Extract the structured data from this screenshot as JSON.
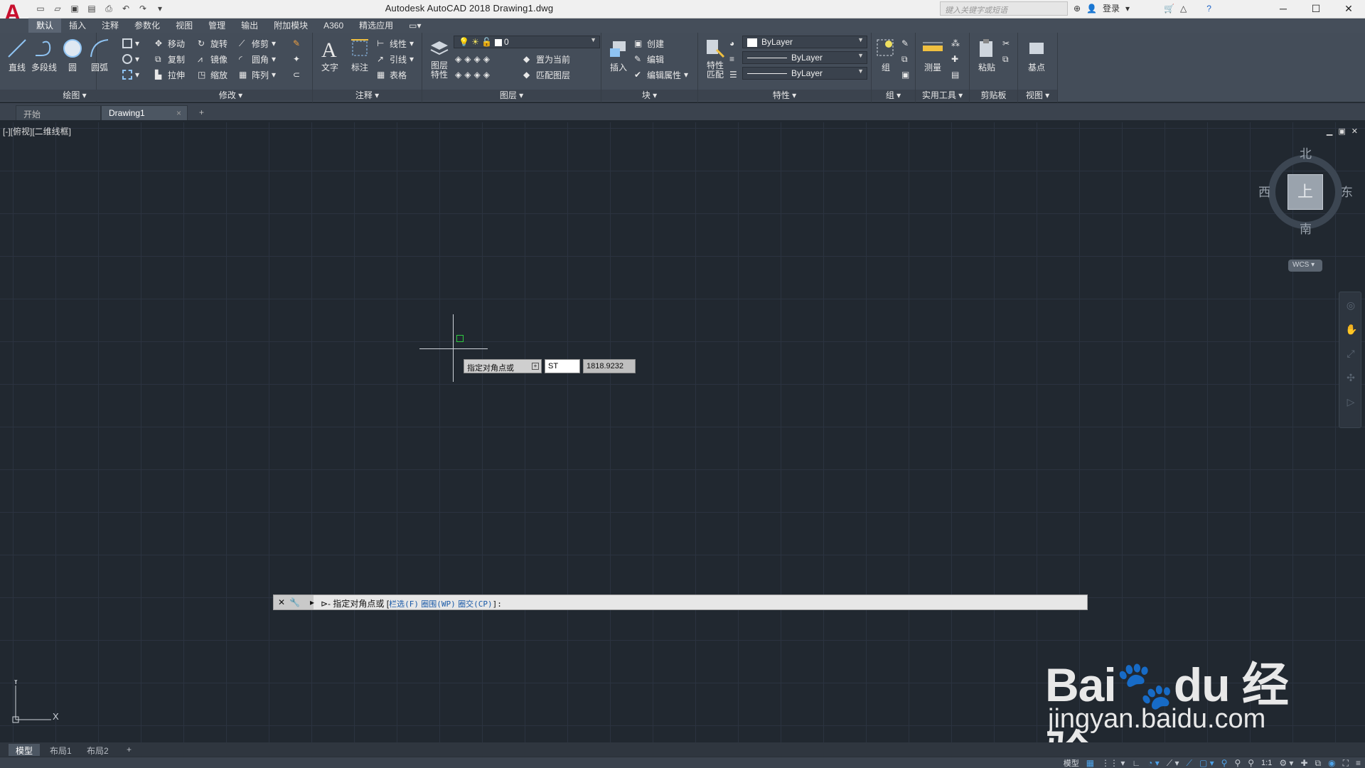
{
  "window": {
    "title": "Autodesk AutoCAD 2018    Drawing1.dwg",
    "search_placeholder": "键入关键字或短语",
    "login_label": "登录",
    "minimize": "─",
    "maximize": "☐",
    "close": "✕"
  },
  "ribbon_tabs": [
    "默认",
    "插入",
    "注释",
    "参数化",
    "视图",
    "管理",
    "输出",
    "附加模块",
    "A360",
    "精选应用"
  ],
  "ribbon": {
    "draw": {
      "title": "绘图 ▾",
      "line": "直线",
      "polyline": "多段线",
      "circle": "圆",
      "arc": "圆弧"
    },
    "modify": {
      "title": "修改 ▾",
      "move": "移动",
      "rotate": "旋转",
      "trim": "修剪",
      "copy": "复制",
      "mirror": "镜像",
      "fillet": "圆角",
      "stretch": "拉伸",
      "scale": "缩放",
      "array": "阵列"
    },
    "annotation": {
      "title": "注释 ▾",
      "text": "文字",
      "dimension": "标注",
      "linear": "线性",
      "leader": "引线",
      "table": "表格"
    },
    "layers": {
      "title": "图层 ▾",
      "layer_properties": "图层\n特性",
      "layer_value": "0",
      "set_current": "置为当前",
      "match_layer": "匹配图层"
    },
    "block": {
      "title": "块 ▾",
      "insert": "插入",
      "create": "创建",
      "edit": "编辑",
      "edit_attributes": "编辑属性"
    },
    "properties": {
      "title": "特性 ▾",
      "match": "特性\n匹配",
      "color": "ByLayer",
      "linetype": "ByLayer",
      "lineweight": "ByLayer"
    },
    "groups": {
      "title": "组 ▾",
      "group": "组"
    },
    "utilities": {
      "title": "实用工具 ▾",
      "measure": "测量"
    },
    "clipboard": {
      "title": "剪贴板",
      "paste": "粘贴"
    },
    "view": {
      "title": "视图 ▾",
      "base": "基点"
    }
  },
  "doc_tabs": {
    "start": "开始",
    "drawing": "Drawing1",
    "close": "×",
    "add": "+"
  },
  "viewport": {
    "label": "[-][俯视][二维线框]",
    "controls": [
      "▁",
      "▣",
      "✕"
    ]
  },
  "dynamic_input": {
    "prompt": "指定对角点或",
    "input_value": "ST",
    "readout": "1818.9232"
  },
  "viewcube": {
    "north": "北",
    "south": "南",
    "east": "东",
    "west": "西",
    "face": "上",
    "wcs": "WCS ▾"
  },
  "ucs": {
    "x": "X",
    "y": "Y"
  },
  "command_line": {
    "prefix": "⊳-",
    "text_main": "指定对角点或 [",
    "opt1": "栏选(F)",
    "opt2": "圈围(WP)",
    "opt3": "圈交(CP)",
    "tail": "]:"
  },
  "watermark": {
    "logo": "Bai🐾du 经验",
    "url": "jingyan.baidu.com"
  },
  "layout_tabs": {
    "model": "模型",
    "layout1": "布局1",
    "layout2": "布局2",
    "add": "+"
  },
  "status_bar": {
    "model": "模型",
    "scale": "1:1"
  }
}
